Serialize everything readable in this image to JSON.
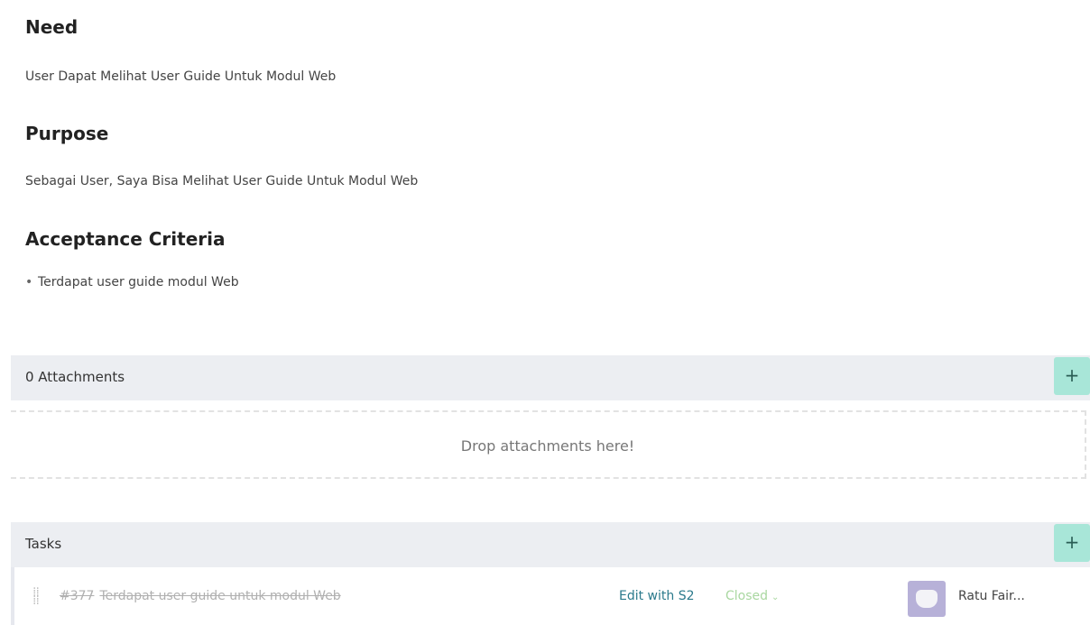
{
  "sections": {
    "need": {
      "heading": "Need",
      "text": "User Dapat Melihat User Guide Untuk Modul Web"
    },
    "purpose": {
      "heading": "Purpose",
      "text": "Sebagai User, Saya Bisa Melihat User Guide Untuk Modul Web"
    },
    "acceptance": {
      "heading": "Acceptance Criteria",
      "items": [
        "Terdapat user guide modul Web"
      ]
    }
  },
  "attachments": {
    "title": "0 Attachments",
    "add_label": "+",
    "dropzone_text": "Drop attachments here!"
  },
  "tasks": {
    "title": "Tasks",
    "add_label": "+",
    "items": [
      {
        "number": "#377",
        "title": "Terdapat user guide untuk modul Web",
        "edit_label": "Edit with S2",
        "status": "Closed",
        "assignee": "Ratu Fair..."
      }
    ]
  },
  "colors": {
    "header_bar": "#eceef2",
    "add_button": "#a8e6d8",
    "status_closed": "#a9d7a0",
    "edit_link": "#2b7a8c"
  },
  "icons": {
    "add": "plus-icon",
    "drag": "drag-handle-icon",
    "status_dropdown": "chevron-down-icon",
    "avatar": "user-avatar-icon"
  }
}
